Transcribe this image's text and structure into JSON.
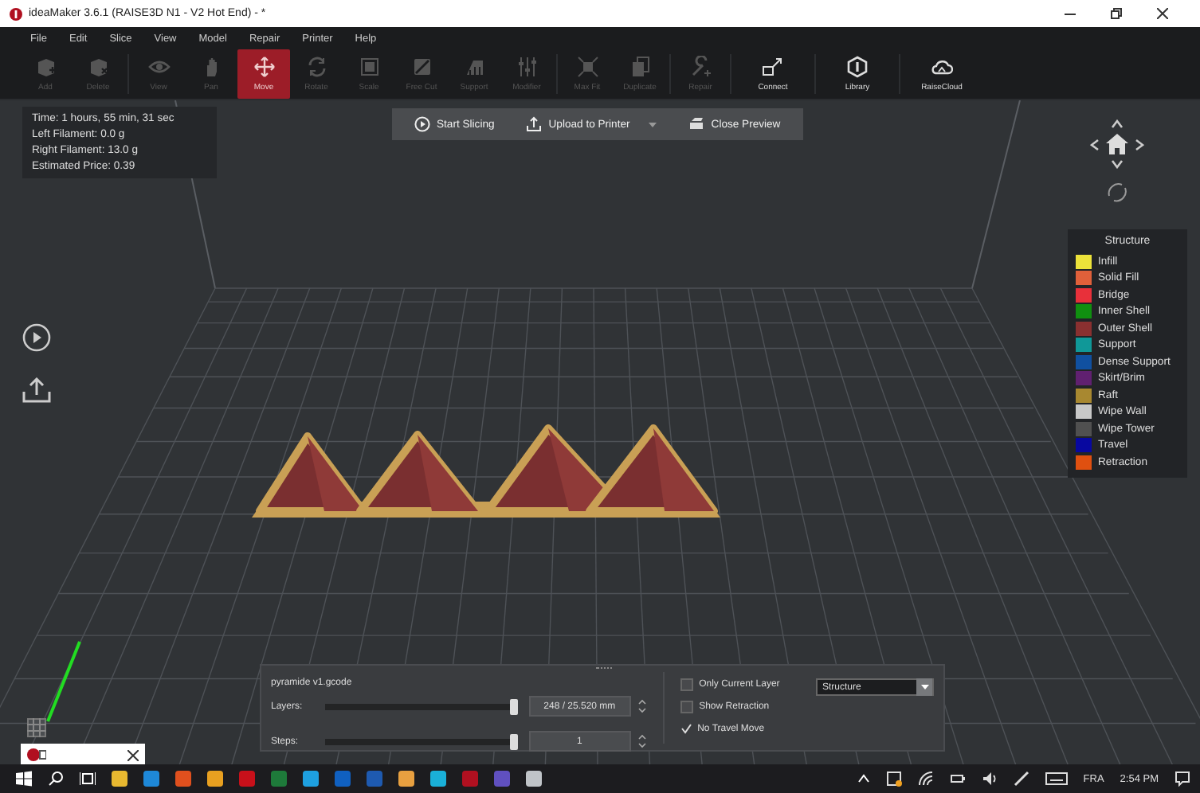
{
  "window": {
    "title": "ideaMaker 3.6.1 (RAISE3D N1 - V2 Hot End) - *"
  },
  "menu": [
    "File",
    "Edit",
    "Slice",
    "View",
    "Model",
    "Repair",
    "Printer",
    "Help"
  ],
  "toolbar": [
    {
      "label": "Add",
      "selected": false,
      "disabled": true
    },
    {
      "label": "Delete",
      "selected": false,
      "disabled": true
    },
    {
      "label": "View",
      "selected": false,
      "disabled": true
    },
    {
      "label": "Pan",
      "selected": false,
      "disabled": true
    },
    {
      "label": "Move",
      "selected": true,
      "disabled": false
    },
    {
      "label": "Rotate",
      "selected": false,
      "disabled": true
    },
    {
      "label": "Scale",
      "selected": false,
      "disabled": true
    },
    {
      "label": "Free Cut",
      "selected": false,
      "disabled": true
    },
    {
      "label": "Support",
      "selected": false,
      "disabled": true
    },
    {
      "label": "Modifier",
      "selected": false,
      "disabled": true
    },
    {
      "label": "Max Fit",
      "selected": false,
      "disabled": true
    },
    {
      "label": "Duplicate",
      "selected": false,
      "disabled": true
    },
    {
      "label": "Repair",
      "selected": false,
      "disabled": true
    },
    {
      "label": "Connect",
      "selected": false,
      "disabled": false
    },
    {
      "label": "Library",
      "selected": false,
      "disabled": false
    },
    {
      "label": "RaiseCloud",
      "selected": false,
      "disabled": false
    }
  ],
  "stats": [
    "Time: 1 hours, 55 min, 31 sec",
    "Left Filament: 0.0 g",
    "Right Filament: 13.0 g",
    "Estimated Price: 0.39"
  ],
  "actions": [
    {
      "label": "Start Slicing",
      "dropdown": false
    },
    {
      "label": "Upload to Printer",
      "dropdown": true
    },
    {
      "label": "Close Preview",
      "dropdown": false
    }
  ],
  "legend": {
    "title": "Structure",
    "items": [
      {
        "label": "Infill",
        "color": "#ece23a"
      },
      {
        "label": "Solid Fill",
        "color": "#e0603a"
      },
      {
        "label": "Bridge",
        "color": "#e8303a"
      },
      {
        "label": "Inner Shell",
        "color": "#109010"
      },
      {
        "label": "Outer Shell",
        "color": "#8a3030"
      },
      {
        "label": "Support",
        "color": "#109898"
      },
      {
        "label": "Dense Support",
        "color": "#1050a0"
      },
      {
        "label": "Skirt/Brim",
        "color": "#602070"
      },
      {
        "label": "Raft",
        "color": "#a88830"
      },
      {
        "label": "Wipe Wall",
        "color": "#c8c8c8"
      },
      {
        "label": "Wipe Tower",
        "color": "#505050"
      },
      {
        "label": "Travel",
        "color": "#0808a0"
      },
      {
        "label": "Retraction",
        "color": "#e05010"
      }
    ]
  },
  "preview": {
    "file": "pyramide v1.gcode",
    "sliders": [
      {
        "label": "Layers:",
        "level": 1,
        "value": "248 / 25.520 mm"
      },
      {
        "label": "Steps:",
        "level": 1,
        "value": "1"
      }
    ],
    "options": [
      {
        "label": "Only Current Layer",
        "checked": false
      },
      {
        "label": "Show Retraction",
        "checked": false
      },
      {
        "label": "No Travel Move",
        "checked": true
      }
    ],
    "color_mode": "Structure"
  },
  "taskbar": {
    "language": "FRA",
    "time": "2:54 PM"
  }
}
